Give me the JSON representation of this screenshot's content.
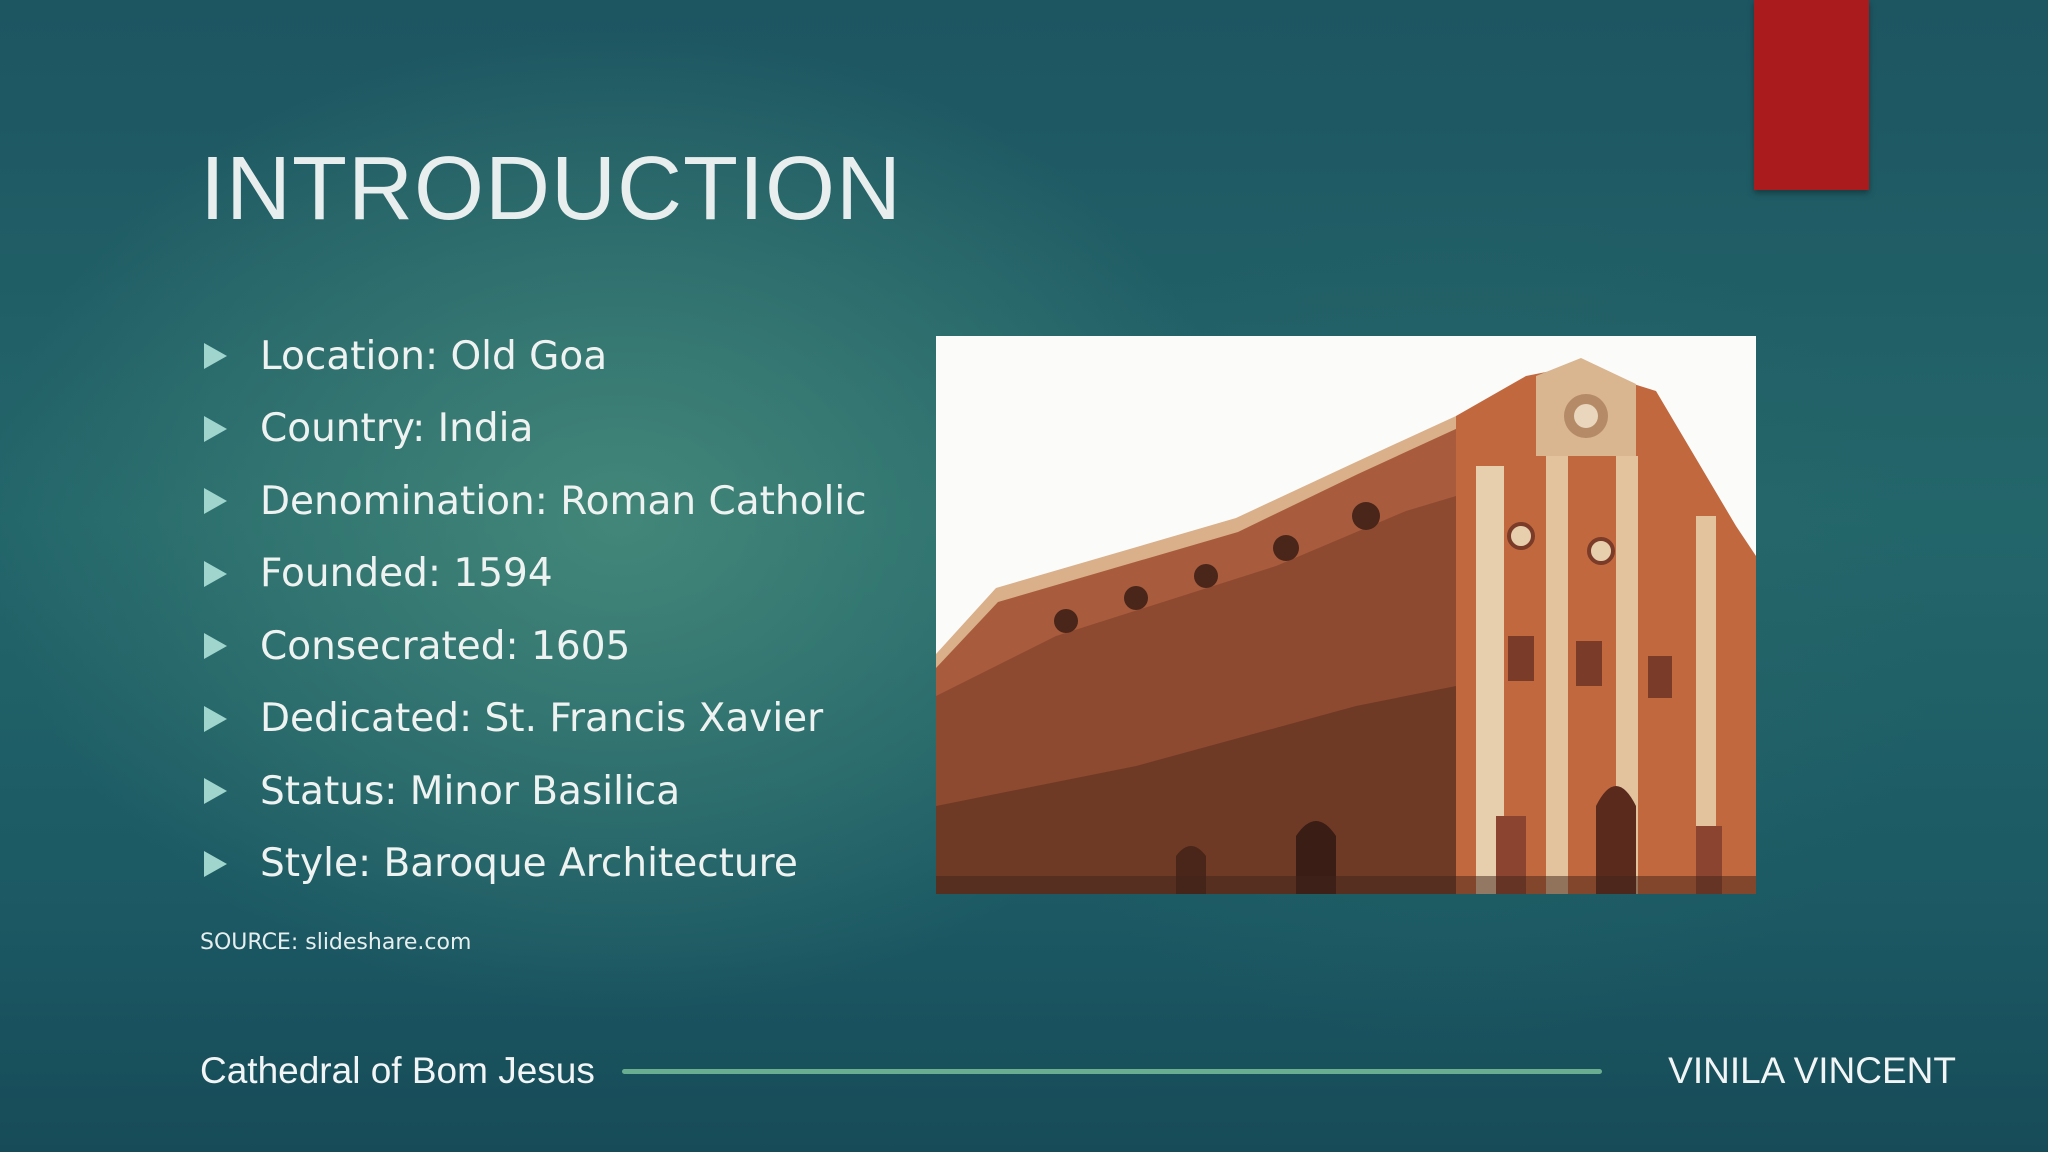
{
  "slide": {
    "title": "INTRODUCTION",
    "bullets": [
      "Location: Old Goa",
      "Country: India",
      "Denomination: Roman Catholic",
      "Founded: 1594",
      "Consecrated: 1605",
      "Dedicated: St. Francis Xavier",
      "Status: Minor Basilica",
      "Style: Baroque Architecture"
    ],
    "source": "SOURCE: slideshare.com",
    "image_description": "",
    "bullet_icon": "triangle-right-icon"
  },
  "footer": {
    "left_text": "Cathedral of Bom Jesus",
    "right_text": "VINILA VINCENT"
  },
  "colors": {
    "background": "#1f5e66",
    "accent_tab": "#a91b1d",
    "bullet": "#9fd5cc",
    "footer_line": "#6aae92",
    "text": "#eef3f2"
  }
}
